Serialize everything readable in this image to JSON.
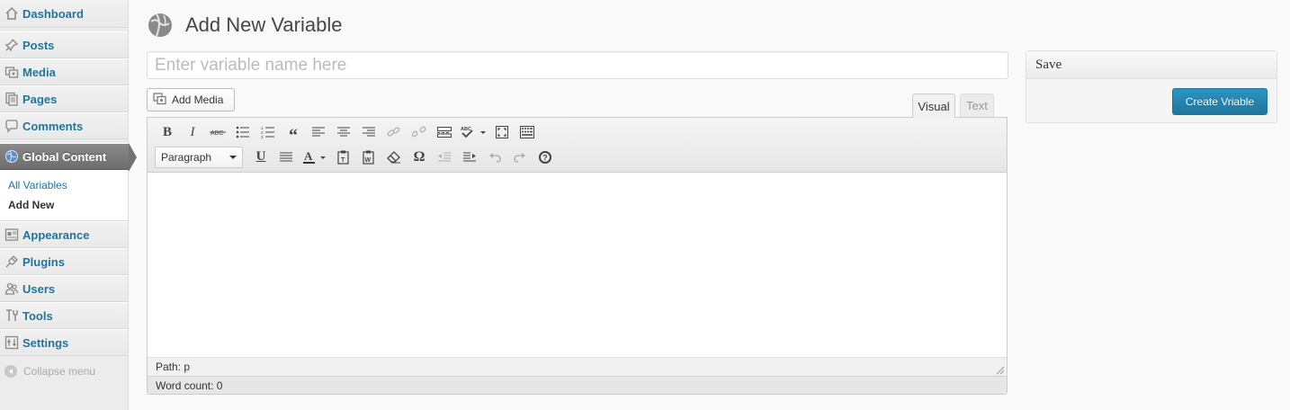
{
  "sidebar": {
    "items": [
      {
        "label": "Dashboard",
        "icon": "dashboard-icon"
      },
      {
        "label": "Posts",
        "icon": "pushpin-icon"
      },
      {
        "label": "Media",
        "icon": "media-icon"
      },
      {
        "label": "Pages",
        "icon": "pages-icon"
      },
      {
        "label": "Comments",
        "icon": "comments-icon"
      },
      {
        "label": "Global Content",
        "icon": "globe-icon"
      },
      {
        "label": "Appearance",
        "icon": "appearance-icon"
      },
      {
        "label": "Plugins",
        "icon": "plugins-icon"
      },
      {
        "label": "Users",
        "icon": "users-icon"
      },
      {
        "label": "Tools",
        "icon": "tools-icon"
      },
      {
        "label": "Settings",
        "icon": "settings-icon"
      }
    ],
    "submenu": [
      "All Variables",
      "Add New"
    ],
    "collapse_label": "Collapse menu"
  },
  "page": {
    "title": "Add New Variable",
    "title_input_placeholder": "Enter variable name here",
    "title_input_value": ""
  },
  "editor": {
    "add_media_label": "Add Media",
    "tabs": {
      "visual": "Visual",
      "text": "Text"
    },
    "format_value": "Paragraph",
    "path": "Path: p",
    "word_count": "Word count: 0"
  },
  "save_box": {
    "title": "Save",
    "button_label": "Create Vriable"
  },
  "colors": {
    "link": "#21759b",
    "primary_button": "#21759b",
    "active_menu": "#6e6e6e"
  }
}
